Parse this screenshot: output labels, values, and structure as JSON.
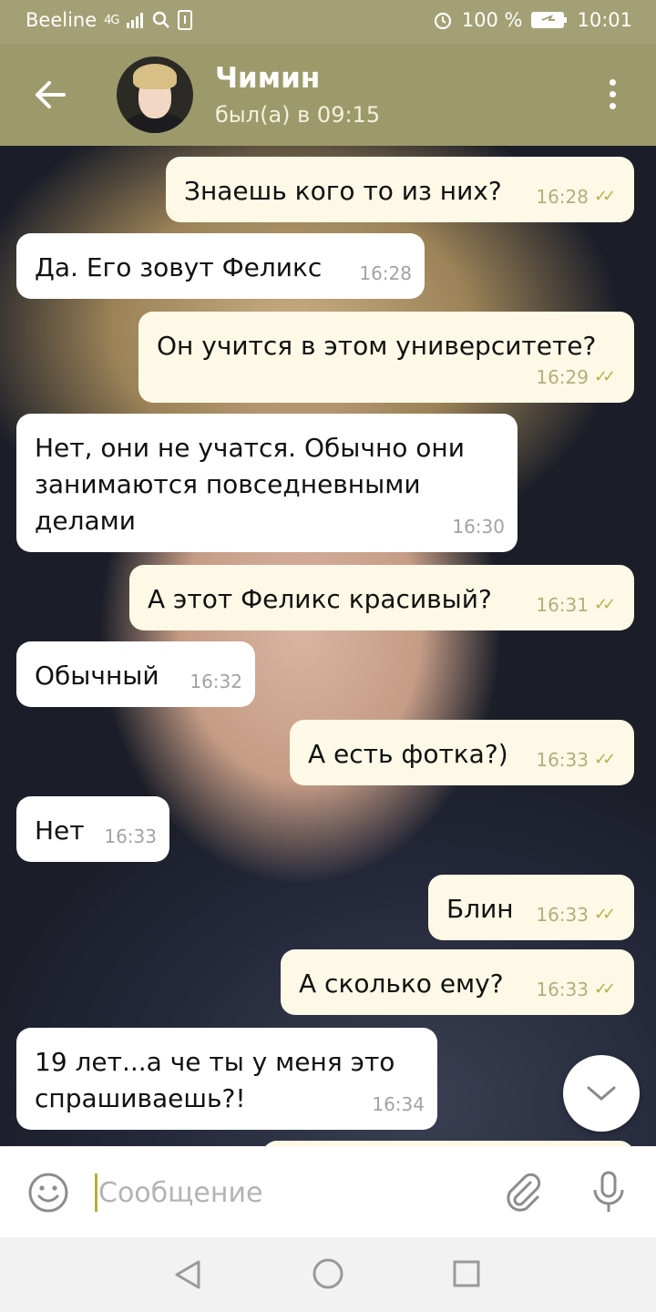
{
  "status_bar": {
    "carrier": "Beeline",
    "network": "4G",
    "battery": "100 %",
    "time": "10:01"
  },
  "header": {
    "contact_name": "Чимин",
    "last_seen": "был(а) в 09:15"
  },
  "messages": [
    {
      "dir": "out",
      "text": "Знаешь кого то из них?",
      "time": "16:28",
      "read": true
    },
    {
      "dir": "in",
      "text": "Да. Его зовут Феликс",
      "time": "16:28"
    },
    {
      "dir": "out",
      "text": "Он учится в этом университете?",
      "time": "16:29",
      "read": true
    },
    {
      "dir": "in",
      "text": "Нет, они не учатся. Обычно они занимаются повседневными делами",
      "time": "16:30"
    },
    {
      "dir": "out",
      "text": "А этот Феликс красивый?",
      "time": "16:31",
      "read": true
    },
    {
      "dir": "in",
      "text": "Обычный",
      "time": "16:32"
    },
    {
      "dir": "out",
      "text": "А есть фотка?)",
      "time": "16:33",
      "read": true
    },
    {
      "dir": "in",
      "text": "Нет",
      "time": "16:33"
    },
    {
      "dir": "out",
      "text": "Блин",
      "time": "16:33",
      "read": true
    },
    {
      "dir": "out",
      "text": "А сколько ему?",
      "time": "16:33",
      "read": true
    },
    {
      "dir": "in",
      "text": "19 лет...а че ты у меня это спрашиваешь?!",
      "time": "16:34"
    }
  ],
  "input": {
    "placeholder": "Сообщение"
  },
  "icons": {
    "back": "arrow-left-icon",
    "menu": "more-vertical-icon",
    "scroll": "chevron-down-icon",
    "emoji": "emoji-icon",
    "attach": "paperclip-icon",
    "mic": "microphone-icon"
  },
  "colors": {
    "header": "#9c9a6b",
    "outgoing_bubble": "#fdf9e6",
    "incoming_bubble": "#ffffff",
    "read_ticks": "#b7b04d"
  }
}
